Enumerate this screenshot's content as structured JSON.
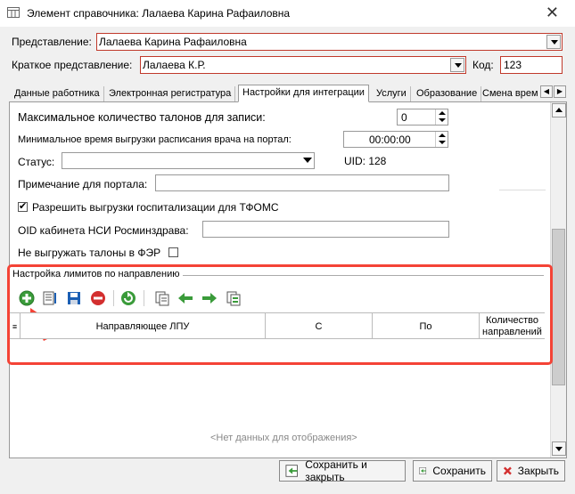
{
  "window": {
    "title": "Элемент справочника: Лалаева Карина Рафаиловна"
  },
  "header": {
    "view_label": "Представление:",
    "view_value": "Лалаева Карина Рафаиловна",
    "short_label": "Краткое представление:",
    "short_value": "Лалаева К.Р.",
    "code_label": "Код:",
    "code_value": "123"
  },
  "tabs": [
    {
      "label": "Данные работника"
    },
    {
      "label": "Электронная регистратура"
    },
    {
      "label": "Настройки для интеграции"
    },
    {
      "label": "Услуги"
    },
    {
      "label": "Образование"
    },
    {
      "label": "Смена врем"
    }
  ],
  "form": {
    "max_tickets_label": "Максимальное количество талонов для записи:",
    "max_tickets_value": "0",
    "min_time_label": "Минимальное время выгрузки расписания врача на портал:",
    "min_time_value": "00:00:00",
    "status_label": "Статус:",
    "status_value": "",
    "uid_text": "UID: 128",
    "note_label": "Примечание для портала:",
    "note_value": "",
    "allow_export_label": "Разрешить выгрузки госпитализации для ТФОМС",
    "oid_label": "OID кабинета НСИ Росминздрава:",
    "oid_value": "",
    "no_export_label": "Не выгружать талоны в ФЭР"
  },
  "limits": {
    "title": "Настройка лимитов по направлению",
    "columns": [
      "Направляющее ЛПУ",
      "С",
      "По",
      "Количество направлений"
    ],
    "empty_text": "<Нет данных для отображения>"
  },
  "buttons": {
    "save_close": "Сохранить и закрыть",
    "save": "Сохранить",
    "close": "Закрыть"
  },
  "colors": {
    "highlight": "#f44336",
    "required_border": "#c0392b",
    "add_green": "#3a9b3a"
  }
}
